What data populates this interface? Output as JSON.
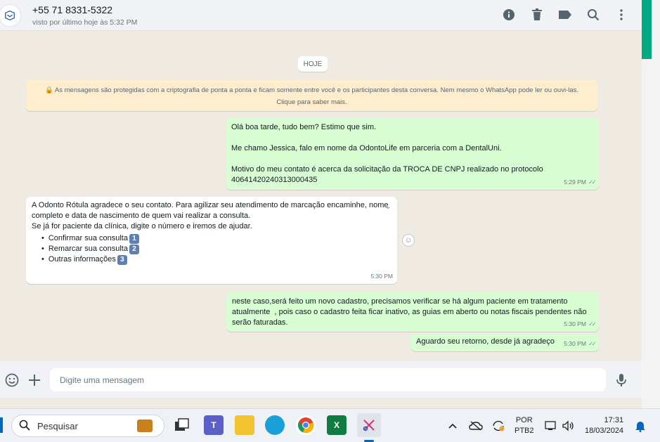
{
  "header": {
    "contact_name": "+55 71 8331-5322",
    "contact_status": "visto por último hoje às 5:32 PM",
    "icons": [
      "info-icon",
      "trash-icon",
      "label-icon",
      "search-icon",
      "menu-icon"
    ]
  },
  "chat": {
    "day_label": "HOJE",
    "encryption_notice_line1": "🔒 As mensagens são protegidas com a criptografia de ponta a ponta e ficam somente entre você e os participantes desta conversa. Nem mesmo o WhatsApp pode ler ou ouvi-las.",
    "encryption_notice_line2": "Clique para saber mais.",
    "messages": [
      {
        "direction": "out",
        "text": "Olá boa tarde, tudo bem? Estimo que sim.\n\nMe chamo Jessica, falo em nome da OdontoLife em parceria com a DentalUni.\n\nMotivo do meu contato é acerca da solicitação da TROCA DE CNPJ realizado no protocolo 40641420240313000435",
        "time": "5:29 PM"
      },
      {
        "direction": "in",
        "text": "A Odonto Rótula agradece o seu contato. Para agilizar seu atendimento de marcação encaminhe, nome completo e data de nascimento de quem vai realizar a consulta.\nSe já for paciente da clínica, digite o número e iremos de ajudar.",
        "options": [
          {
            "label": "Confirmar sua consulta",
            "badge": "1"
          },
          {
            "label": "Remarcar sua consulta",
            "badge": "2"
          },
          {
            "label": "Outras informações",
            "badge": "3"
          }
        ],
        "time": "5:30 PM"
      },
      {
        "direction": "out",
        "text": "neste caso,será feito um novo cadastro, precisamos verificar se há algum paciente em tratamento atualmente  , pois caso o cadastro feita ficar inativo, as guias em aberto ou notas fiscais pendentes não serão faturadas.",
        "time": "5:30 PM"
      },
      {
        "direction": "out",
        "text": "Aguardo seu retorno, desde já agradeço",
        "time": "5:30 PM"
      }
    ]
  },
  "composer": {
    "placeholder": "Digite uma mensagem"
  },
  "taskbar": {
    "search_label": "Pesquisar",
    "lang_line1": "POR",
    "lang_line2": "PTB2",
    "time": "17:31",
    "date": "18/03/2024"
  },
  "colors": {
    "outgoing_bubble": "#d9fdd3",
    "incoming_bubble": "#ffffff",
    "accent": "#00a884",
    "chat_bg": "#efeae2"
  }
}
